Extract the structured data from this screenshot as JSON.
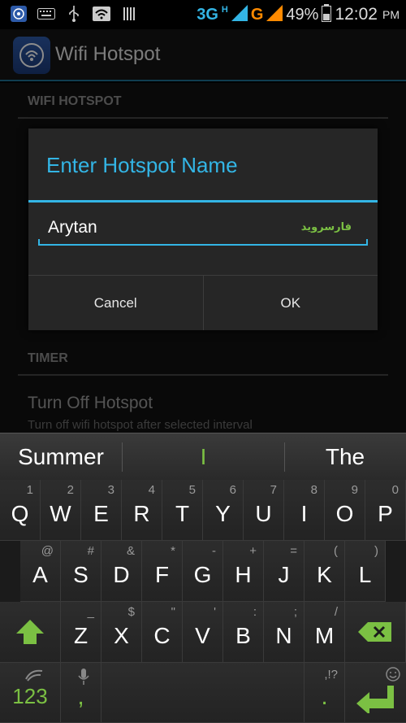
{
  "status_bar": {
    "network_3g": "3G",
    "network_h": "H",
    "network_g": "G",
    "battery": "49%",
    "time": "12:02",
    "ampm": "PM",
    "icons": [
      "hotspot-icon",
      "keyboard-icon",
      "usb-icon",
      "wifi-icon",
      "sim-icon"
    ]
  },
  "action_bar": {
    "title": "Wifi Hotspot",
    "icon": "wifi-hotspot-app-icon"
  },
  "background": {
    "section_wifi": "WIFI HOTSPOT",
    "section_timer": "TIMER",
    "timer_title": "Turn Off Hotspot",
    "timer_sub": "Turn off wifi hotspot after selected interval"
  },
  "dialog": {
    "title": "Enter Hotspot Name",
    "input_value": "Arytan",
    "watermark": "فارسروید",
    "cancel": "Cancel",
    "ok": "OK"
  },
  "suggestions": {
    "left": "Summer",
    "middle": "I",
    "right": "The"
  },
  "keyboard": {
    "row1": [
      {
        "key": "Q",
        "hint": "1"
      },
      {
        "key": "W",
        "hint": "2"
      },
      {
        "key": "E",
        "hint": "3"
      },
      {
        "key": "R",
        "hint": "4"
      },
      {
        "key": "T",
        "hint": "5"
      },
      {
        "key": "Y",
        "hint": "6"
      },
      {
        "key": "U",
        "hint": "7"
      },
      {
        "key": "I",
        "hint": "8"
      },
      {
        "key": "O",
        "hint": "9"
      },
      {
        "key": "P",
        "hint": "0"
      }
    ],
    "row2": [
      {
        "key": "A",
        "hint": "@"
      },
      {
        "key": "S",
        "hint": "#"
      },
      {
        "key": "D",
        "hint": "&"
      },
      {
        "key": "F",
        "hint": "*"
      },
      {
        "key": "G",
        "hint": "-"
      },
      {
        "key": "H",
        "hint": "+"
      },
      {
        "key": "J",
        "hint": "="
      },
      {
        "key": "K",
        "hint": "("
      },
      {
        "key": "L",
        "hint": ")"
      }
    ],
    "row3": [
      {
        "key": "Z",
        "hint": "_"
      },
      {
        "key": "X",
        "hint": "$"
      },
      {
        "key": "C",
        "hint": "\""
      },
      {
        "key": "V",
        "hint": "'"
      },
      {
        "key": "B",
        "hint": ":"
      },
      {
        "key": "N",
        "hint": ";"
      },
      {
        "key": "M",
        "hint": "/"
      }
    ],
    "row4": {
      "numbers": "123",
      "comma": ",",
      "period": ".",
      "period_hint": ",!?"
    },
    "accent_color": "#7bc043"
  }
}
